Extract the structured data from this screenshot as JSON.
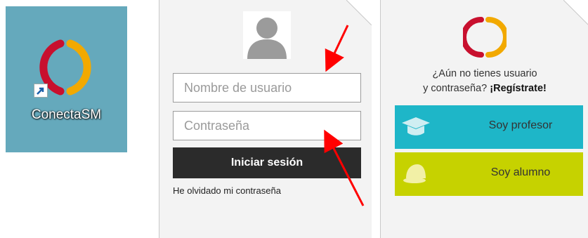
{
  "desktop": {
    "shortcut_label": "ConectaSM",
    "bg_color": "#65a9bc",
    "icon": "conectasm-logo-icon"
  },
  "login": {
    "avatar_icon": "user-avatar-icon",
    "username_placeholder": "Nombre de usuario",
    "password_placeholder": "Contraseña",
    "submit_label": "Iniciar sesión",
    "forgot_link": "He olvidado mi contraseña"
  },
  "register": {
    "prompt_line1": "¿Aún no tienes usuario",
    "prompt_line2": "y contraseña?",
    "prompt_cta": "¡Regístrate!",
    "roles": [
      {
        "label": "Soy profesor",
        "icon": "graduation-cap-icon",
        "color": "#1eb6c8"
      },
      {
        "label": "Soy alumno",
        "icon": "baseball-cap-icon",
        "color": "#c6d200"
      }
    ]
  },
  "annotations": {
    "arrow_color": "#ff0000"
  }
}
